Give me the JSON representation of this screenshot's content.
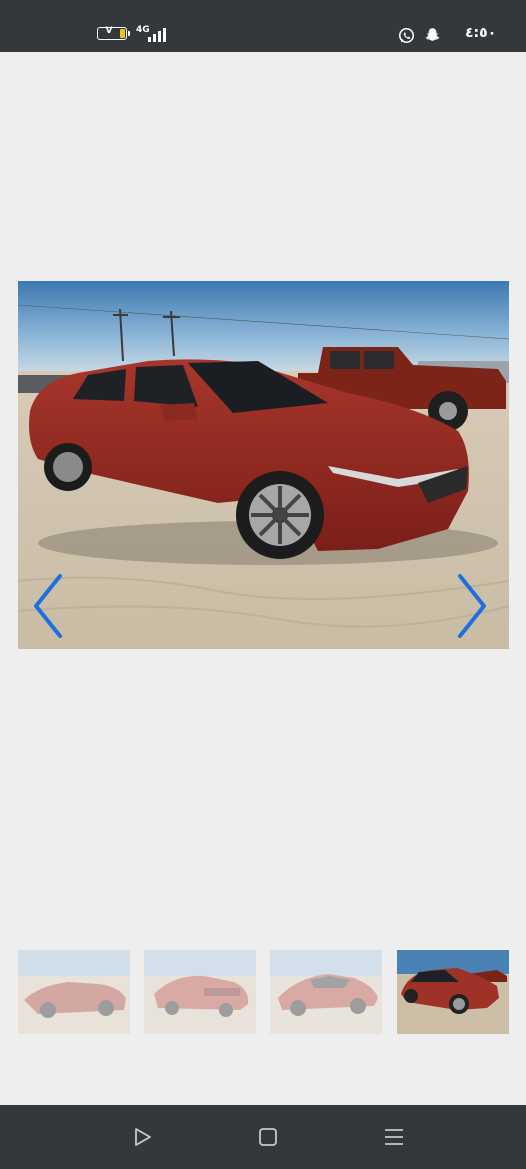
{
  "status_bar": {
    "battery_label": "V",
    "network_label": "4G",
    "clock": "٤:٥٠",
    "icons": [
      "battery-icon",
      "signal-icon",
      "whatsapp-icon",
      "snapchat-icon"
    ]
  },
  "gallery": {
    "main_photo": "red-sedan-photo",
    "prev_icon": "chevron-left-icon",
    "next_icon": "chevron-right-icon",
    "accent_color": "#1e6fe0",
    "thumbnails": [
      {
        "name": "thumbnail-rear-quarter",
        "selected": false
      },
      {
        "name": "thumbnail-rear",
        "selected": false
      },
      {
        "name": "thumbnail-side",
        "selected": false
      },
      {
        "name": "thumbnail-front-quarter",
        "selected": true
      }
    ]
  },
  "nav_bar": {
    "icons": [
      "back-icon",
      "home-icon",
      "recents-icon"
    ]
  }
}
